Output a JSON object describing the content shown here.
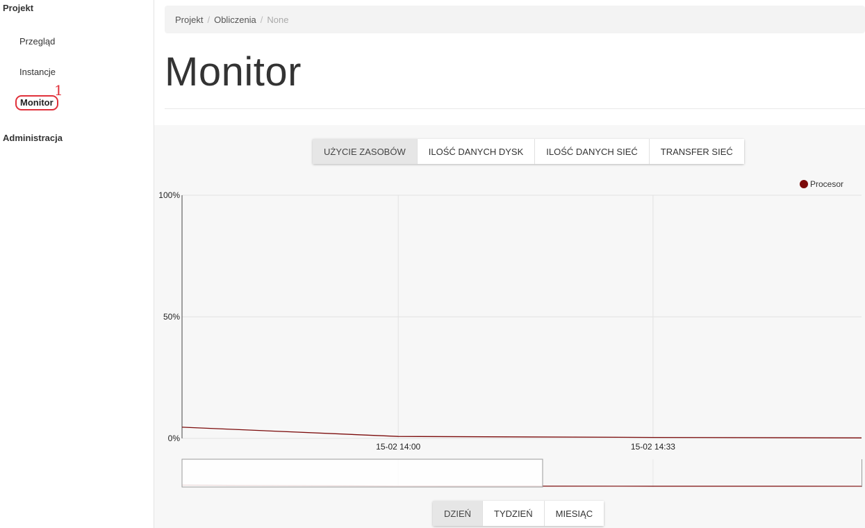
{
  "sidebar": {
    "section_project": "Projekt",
    "items": [
      {
        "label": "Przegląd"
      },
      {
        "label": "Instancje"
      },
      {
        "label": "Monitor"
      }
    ],
    "section_admin": "Administracja",
    "annotation": "1"
  },
  "breadcrumb": {
    "items": [
      "Projekt",
      "Obliczenia",
      "None"
    ],
    "separator": "/"
  },
  "page": {
    "title": "Monitor"
  },
  "tabs": {
    "items": [
      "UŻYCIE ZASOBÓW",
      "ILOŚĆ DANYCH DYSK",
      "ILOŚĆ DANYCH SIEĆ",
      "TRANSFER SIEĆ"
    ],
    "active_index": 0
  },
  "ranges": {
    "items": [
      "DZIEŃ",
      "TYDZIEŃ",
      "MIESIĄC"
    ],
    "active_index": 0
  },
  "colors": {
    "series": "#7b0a0a",
    "annotation": "#e0303a"
  },
  "chart_data": {
    "type": "line",
    "legend_position": "top-right",
    "grid": true,
    "y_ticks": [
      "100%",
      "50%",
      "0%"
    ],
    "ylim": [
      0,
      100
    ],
    "x_ticks": [
      "15-02 14:00",
      "15-02 14:33"
    ],
    "series": [
      {
        "name": "Procesor",
        "color": "#7b0a0a",
        "points": [
          {
            "t": "15-02 13:32",
            "y": 4.6
          },
          {
            "t": "15-02 14:00",
            "y": 0.8
          },
          {
            "t": "15-02 14:33",
            "y": 0.4
          },
          {
            "t": "15-02 15:00",
            "y": 0.2
          }
        ]
      }
    ]
  }
}
